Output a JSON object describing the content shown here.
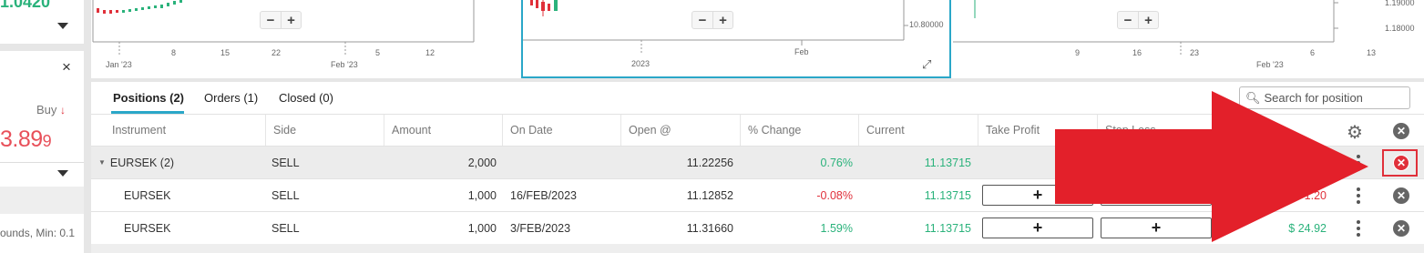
{
  "left_panel": {
    "top_price": "1.0420",
    "close_symbol": "×",
    "buy_label": "Buy",
    "buy_arrow": "↓",
    "price_main": "3.89",
    "price_small": "9",
    "min_note": "ounds, Min: 0.1"
  },
  "charts": {
    "chart1": {
      "xticks": [
        "Jan '23",
        "8",
        "15",
        "22",
        "Feb '23",
        "5",
        "12"
      ]
    },
    "chart2": {
      "yticks": [
        "10.80000"
      ],
      "xticks": [
        "2023",
        "Feb"
      ]
    },
    "chart3": {
      "yticks": [
        "1.19000",
        "1.18000"
      ],
      "xticks": [
        "9",
        "16",
        "23",
        "Feb '23",
        "6",
        "13"
      ]
    },
    "zoom_minus": "−",
    "zoom_plus": "+"
  },
  "tabs": [
    {
      "label": "Positions (2)"
    },
    {
      "label": "Orders (1)"
    },
    {
      "label": "Closed (0)"
    }
  ],
  "search": {
    "placeholder": "Search for position"
  },
  "columns": [
    "Instrument",
    "Side",
    "Amount",
    "On Date",
    "Open @",
    "% Change",
    "Current",
    "Take Profit",
    "Stop Loss"
  ],
  "group_row": {
    "instrument": "EURSEK (2)",
    "side": "SELL",
    "amount": "2,000",
    "on_date": "",
    "open": "11.22256",
    "change": "0.76%",
    "current": "11.13715"
  },
  "rows": [
    {
      "instrument": "EURSEK",
      "side": "SELL",
      "amount": "1,000",
      "on_date": "16/FEB/2023",
      "open": "11.12852",
      "change": "-0.08%",
      "current": "11.13715",
      "take_profit": "+",
      "stop_loss": "+",
      "pl": "$ 1.20"
    },
    {
      "instrument": "EURSEK",
      "side": "SELL",
      "amount": "1,000",
      "on_date": "3/FEB/2023",
      "open": "11.31660",
      "change": "1.59%",
      "current": "11.13715",
      "take_profit": "+",
      "stop_loss": "+",
      "pl": "$ 24.92"
    }
  ],
  "colors": {
    "accent": "#2aa7c8",
    "positive": "#2ab27b",
    "negative": "#e0303a",
    "arrow": "#e3202a"
  },
  "icons": [
    "search-icon",
    "gear-icon",
    "close-circle-icon",
    "kebab-icon",
    "expand-icon",
    "caret-down-icon"
  ]
}
